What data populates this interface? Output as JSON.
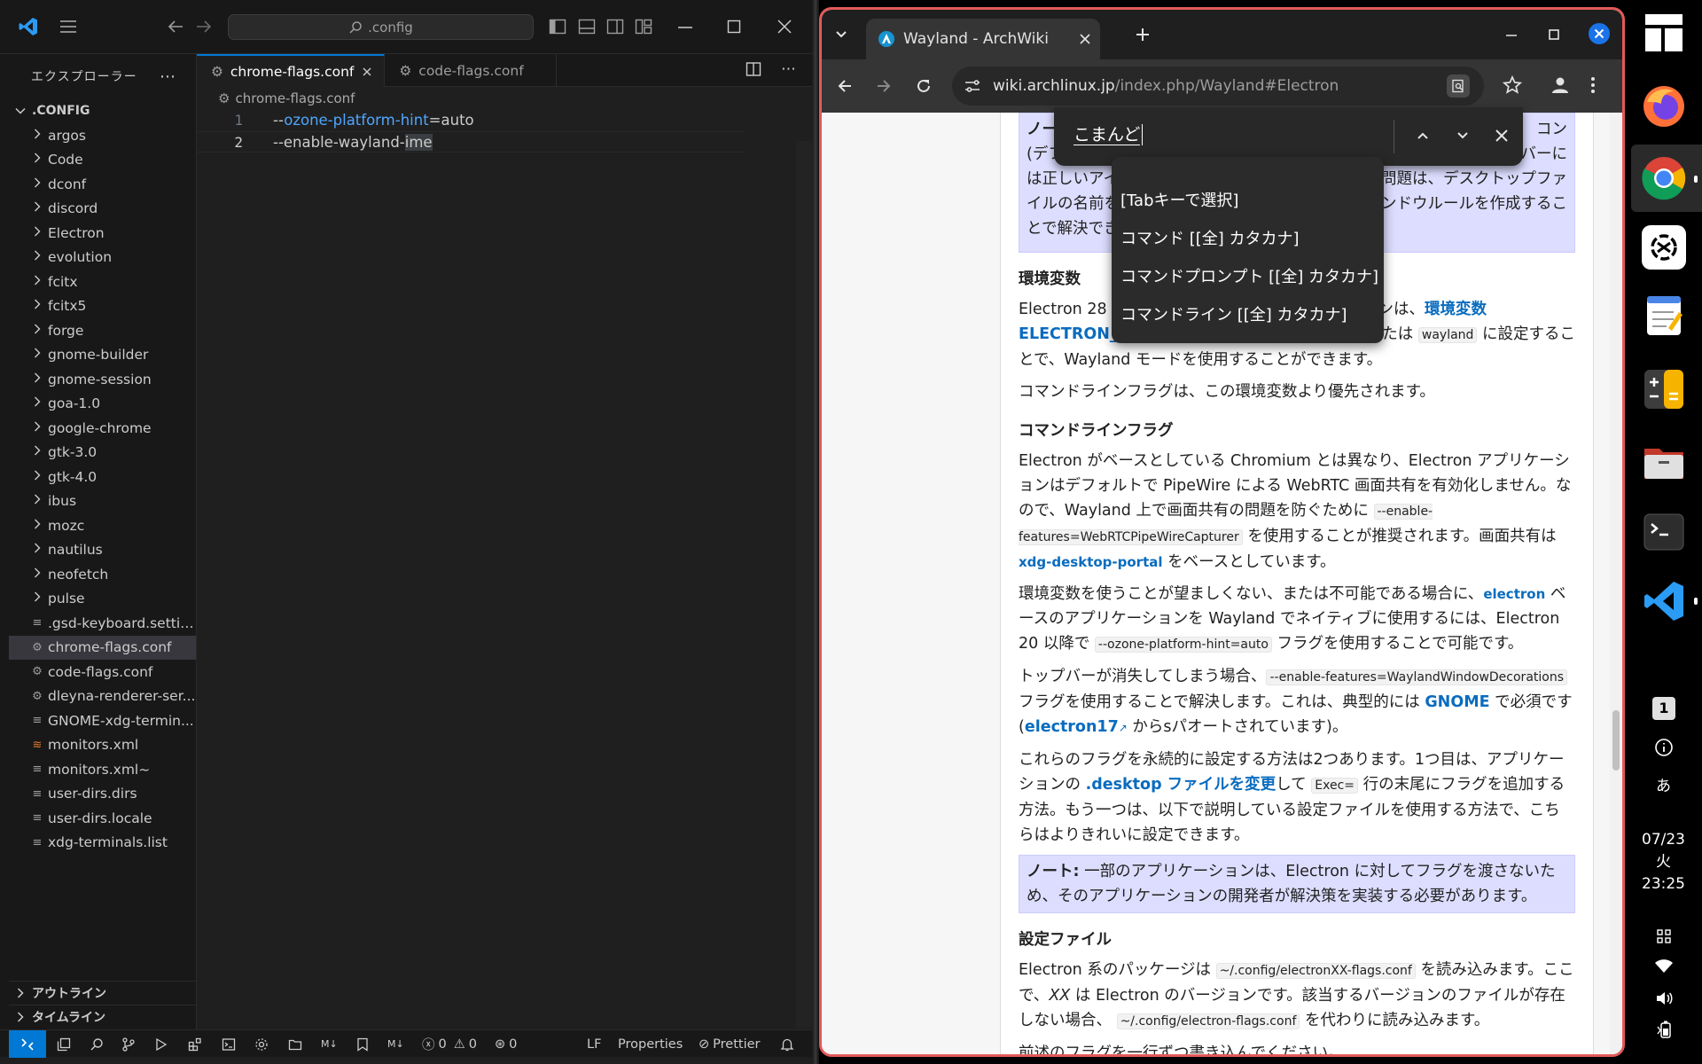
{
  "vscode": {
    "search_label": ".config",
    "explorer_title": "エクスプローラー",
    "root_folder": ".CONFIG",
    "tree": [
      {
        "type": "folder",
        "label": "argos"
      },
      {
        "type": "folder",
        "label": "Code"
      },
      {
        "type": "folder",
        "label": "dconf"
      },
      {
        "type": "folder",
        "label": "discord"
      },
      {
        "type": "folder",
        "label": "Electron"
      },
      {
        "type": "folder",
        "label": "evolution"
      },
      {
        "type": "folder",
        "label": "fcitx"
      },
      {
        "type": "folder",
        "label": "fcitx5"
      },
      {
        "type": "folder",
        "label": "forge"
      },
      {
        "type": "folder",
        "label": "gnome-builder"
      },
      {
        "type": "folder",
        "label": "gnome-session"
      },
      {
        "type": "folder",
        "label": "goa-1.0"
      },
      {
        "type": "folder",
        "label": "google-chrome"
      },
      {
        "type": "folder",
        "label": "gtk-3.0"
      },
      {
        "type": "folder",
        "label": "gtk-4.0"
      },
      {
        "type": "folder",
        "label": "ibus"
      },
      {
        "type": "folder",
        "label": "mozc"
      },
      {
        "type": "folder",
        "label": "nautilus"
      },
      {
        "type": "folder",
        "label": "neofetch"
      },
      {
        "type": "folder",
        "label": "pulse"
      },
      {
        "type": "file",
        "label": ".gsd-keyboard.settin..."
      },
      {
        "type": "gear",
        "label": "chrome-flags.conf",
        "selected": true
      },
      {
        "type": "gear",
        "label": "code-flags.conf"
      },
      {
        "type": "gear",
        "label": "dleyna-renderer-ser..."
      },
      {
        "type": "file",
        "label": "GNOME-xdg-termin..."
      },
      {
        "type": "rss",
        "label": "monitors.xml"
      },
      {
        "type": "file",
        "label": "monitors.xml~"
      },
      {
        "type": "file",
        "label": "user-dirs.dirs"
      },
      {
        "type": "file",
        "label": "user-dirs.locale"
      },
      {
        "type": "file",
        "label": "xdg-terminals.list"
      }
    ],
    "outline_label": "アウトライン",
    "timeline_label": "タイムライン",
    "tabs": [
      {
        "label": "chrome-flags.conf",
        "active": true
      },
      {
        "label": "code-flags.conf",
        "active": false
      }
    ],
    "breadcrumb": "chrome-flags.conf",
    "code": {
      "line1": {
        "num": "1",
        "prefix": "--",
        "key": "ozone-platform-hint",
        "suffix": "=auto"
      },
      "line2": {
        "num": "2",
        "prefix": "--enable-wayland-",
        "hl": "ime"
      }
    },
    "status": {
      "errors": "0",
      "warnings": "0",
      "ports": "0",
      "eol": "LF",
      "lang": "Properties",
      "formatter": "Prettier",
      "md1": "M↓",
      "md2": "M↓"
    },
    "accent": "#0078d4"
  },
  "chrome": {
    "tab_title": "Wayland - ArchWiki",
    "url_host": "wiki.archlinux.jp",
    "url_path": "/index.php/Wayland#Electron",
    "find_query": "こまんど",
    "ime_options": [
      "[Tabキーで選択]",
      "コマンド [[全] カタカナ]",
      "コマンドプロンプト [[全] カタカナ]",
      "コマンドライン [[全] カタカナ]"
    ],
    "frame_color": "#e35a5a"
  },
  "article": {
    "note1_label": "ノー",
    "note1_line1_end": "コン",
    "note1_line2_start": "(デフ",
    "note1_line2_end": "バーに",
    "note1_line3_start": "は正しいアイ",
    "note1_line3_end": "の問題は、デスクトップファ",
    "note1_line4_start": "イルの名前を",
    "note1_line4_end": "ンドウルールを作成するこ",
    "note1_line5": "とで解決でき",
    "h_env": "環境変数",
    "env_p1_a": "Electron 28 及",
    "env_p1_b": "ンは、",
    "env_link1": "環境変数",
    "env_link2": "ELECTRON_",
    "env_p1_c": "または",
    "env_code": "wayland",
    "env_p1_d": "に設定するこ",
    "env_p1_e": "とで、Wayland モードを使用することができます。",
    "env_p2": "コマンドラインフラグは、この環境変数より優先されます。",
    "h_flags": "コマンドラインフラグ",
    "fl_p1_a": "Electron がベースとしている Chromium とは異なり、Electron アプリケーションはデフォルトで PipeWire による WebRTC 画面共有を有効化しません。なので、Wayland 上で画面共有の問題を防ぐために",
    "fl_p1_code": "--enable-features=WebRTCPipeWireCapturer",
    "fl_p1_b": "を使用することが推奨されます。画面共有は",
    "fl_p1_link": "xdg-desktop-portal",
    "fl_p1_c": "をベースとしています。",
    "fl_p2_a": "環境変数を使うことが望ましくない、または不可能である場合に、",
    "fl_p2_link": "electron",
    "fl_p2_b": "ベースのアプリケーションを Wayland でネイティブに使用するには、Electron 20 以降で",
    "fl_p2_code": "--ozone-platform-hint=auto",
    "fl_p2_c": "フラグを使用することで可能です。",
    "fl_p3_a": "トップバーが消失してしまう場合、",
    "fl_p3_code": "--enable-features=WaylandWindowDecorations",
    "fl_p3_b": "フラグを使用することで解決します。これは、典型的には",
    "fl_p3_link": "GNOME",
    "fl_p3_c": "で必須です (",
    "fl_p3_link2": "electron17",
    "fl_p3_d": "からsパオートされています)。",
    "fl_p4_a": "これらのフラグを永続的に設定する方法は2つあります。1つ目は、アプリケーションの",
    "fl_p4_link": ".desktop ファイルを変更",
    "fl_p4_b": "して",
    "fl_p4_code": "Exec=",
    "fl_p4_c": "行の末尾にフラグを追加する方法。もう一つは、以下で説明している設定ファイルを使用する方法で、こちらはよりきれいに設定できます。",
    "note2_label": "ノート:",
    "note2_text": "一部のアプリケーションは、Electron に対してフラグを渡さないため、そのアプリケーションの開発者が解決策を実装する必要があります。",
    "h_conf": "設定ファイル",
    "cf_p1_a": "Electron 系のパッケージは",
    "cf_p1_code": "~/.config/electronXX-flags.conf",
    "cf_p1_b": "を読み込みます。ここで、",
    "cf_p1_xx": "XX",
    "cf_p1_c": "は Electron のバージョンです。該当するバージョンのファイルが存在しない場合、",
    "cf_p1_code2": "~/.config/electron-flags.conf",
    "cf_p1_d": "を代わりに読み込みます。",
    "cf_p2": "前述のフラグを一行ずつ書き込んでください。"
  },
  "dock": {
    "workspace": "1",
    "ime_indicator": "あ",
    "date": "07/23",
    "weekday": "火",
    "time": "23:25"
  }
}
